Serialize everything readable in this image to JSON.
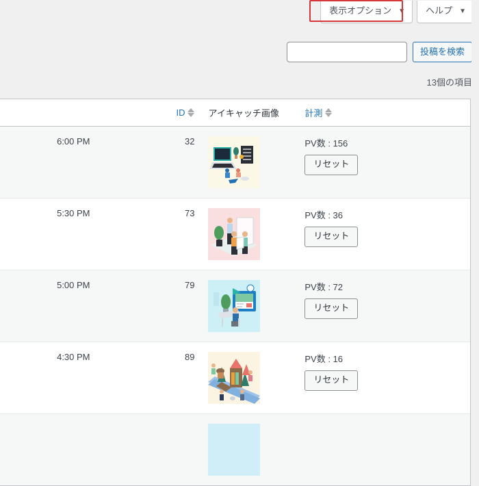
{
  "screen_meta": {
    "screen_options_label": "表示オプション",
    "help_label": "ヘルプ",
    "caret_glyph": "▼"
  },
  "search": {
    "value": "",
    "placeholder": "",
    "submit_label": "投稿を検索"
  },
  "tablenav": {
    "displaying_num": "13個の項目"
  },
  "table": {
    "columns": [
      {
        "key": "title",
        "label": "",
        "sortable": false
      },
      {
        "key": "date",
        "label": "",
        "sortable": false
      },
      {
        "key": "id",
        "label": "ID",
        "sortable": true
      },
      {
        "key": "thumb",
        "label": "アイキャッチ画像",
        "sortable": false
      },
      {
        "key": "count",
        "label": "計測",
        "sortable": true
      }
    ],
    "reset_label": "リセット",
    "rows": [
      {
        "date": "6:00 PM",
        "id": "32",
        "pv": "PV数 : 156",
        "thumb": "laptop-server-illustration"
      },
      {
        "date": "5:30 PM",
        "id": "73",
        "pv": "PV数 : 36",
        "thumb": "office-meeting-illustration"
      },
      {
        "date": "5:00 PM",
        "id": "79",
        "pv": "PV数 : 72",
        "thumb": "presentation-desk-illustration"
      },
      {
        "date": "4:30 PM",
        "id": "89",
        "pv": "PV数 : 16",
        "thumb": "town-park-illustration"
      }
    ]
  },
  "colors": {
    "link_blue": "#2271b1",
    "highlight_red": "#d63638",
    "page_bg": "#f0f0f1",
    "row_alt_bg": "#f6f7f7",
    "border": "#c3c4c7"
  }
}
